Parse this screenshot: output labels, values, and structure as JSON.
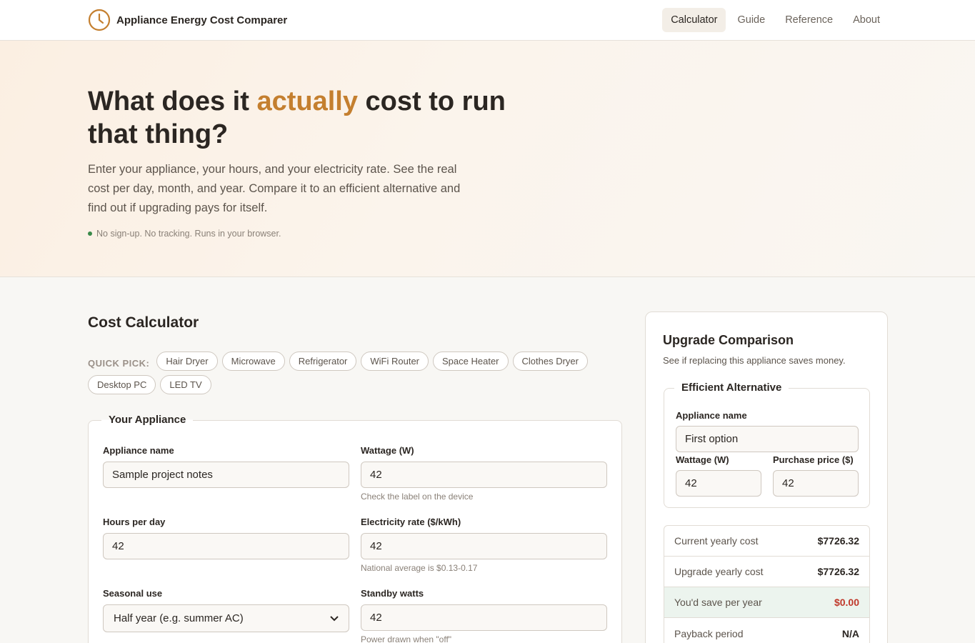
{
  "header": {
    "brand": "Appliance Energy Cost Comparer",
    "nav": [
      "Calculator",
      "Guide",
      "Reference",
      "About"
    ],
    "active": 0
  },
  "hero": {
    "title_pre": "What does it ",
    "title_accent": "actually",
    "title_post": " cost to run that thing?",
    "subtitle": "Enter your appliance, your hours, and your electricity rate. See the real cost per day, month, and year. Compare it to an efficient alternative and find out if upgrading pays for itself.",
    "note": "No sign-up. No tracking. Runs in your browser."
  },
  "calculator": {
    "title": "Cost Calculator",
    "quick_label": "QUICK PICK:",
    "quick_picks": [
      "Hair Dryer",
      "Microwave",
      "Refrigerator",
      "WiFi Router",
      "Space Heater",
      "Clothes Dryer",
      "Desktop PC",
      "LED TV"
    ],
    "legend": "Your Appliance",
    "fields": {
      "name": {
        "label": "Appliance name",
        "value": "Sample project notes"
      },
      "wattage": {
        "label": "Wattage (W)",
        "value": "42",
        "hint": "Check the label on the device"
      },
      "hours": {
        "label": "Hours per day",
        "value": "42"
      },
      "rate": {
        "label": "Electricity rate ($/kWh)",
        "value": "42",
        "hint": "National average is $0.13-0.17"
      },
      "seasonal": {
        "label": "Seasonal use",
        "value": "Half year (e.g. summer AC)"
      },
      "standby": {
        "label": "Standby watts",
        "value": "42",
        "hint": "Power drawn when \"off\""
      }
    }
  },
  "upgrade": {
    "title": "Upgrade Comparison",
    "subtitle": "See if replacing this appliance saves money.",
    "legend": "Efficient Alternative",
    "name_label": "Appliance name",
    "name_value": "First option",
    "wattage_label": "Wattage (W)",
    "wattage_value": "42",
    "price_label": "Purchase price ($)",
    "price_value": "42",
    "results": [
      {
        "label": "Current yearly cost",
        "value": "$7726.32"
      },
      {
        "label": "Upgrade yearly cost",
        "value": "$7726.32"
      },
      {
        "label": "You'd save per year",
        "value": "$0.00"
      },
      {
        "label": "Payback period",
        "value": "N/A"
      }
    ]
  },
  "colors": {
    "accent": "#c47f2f",
    "success_dot": "#3a8a4a",
    "savings_value": "#c0392b"
  }
}
